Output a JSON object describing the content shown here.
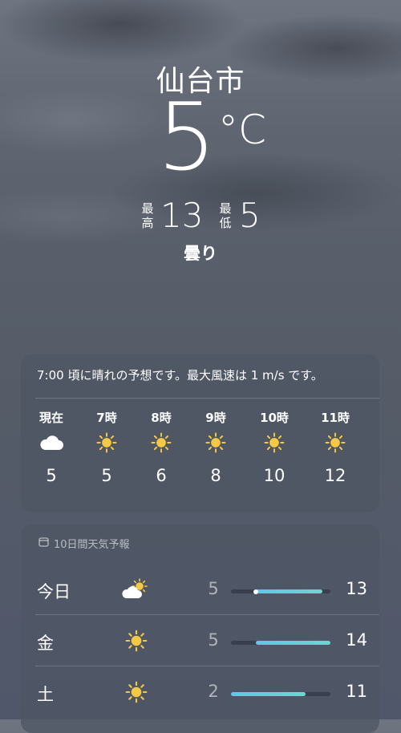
{
  "current": {
    "city": "仙台市",
    "temperature": "5",
    "unit": "°C",
    "high_label": "最高",
    "high": "13",
    "low_label": "最低",
    "low": "5",
    "condition": "曇り"
  },
  "hourly": {
    "summary": "7:00 頃に晴れの予想です。最大風速は 1 m/s です。",
    "items": [
      {
        "time": "現在",
        "icon": "cloud-icon",
        "temp": "5"
      },
      {
        "time": "7時",
        "icon": "sun-icon",
        "temp": "5"
      },
      {
        "time": "8時",
        "icon": "sun-icon",
        "temp": "6"
      },
      {
        "time": "9時",
        "icon": "sun-icon",
        "temp": "8"
      },
      {
        "time": "10時",
        "icon": "sun-icon",
        "temp": "10"
      },
      {
        "time": "11時",
        "icon": "sun-icon",
        "temp": "12"
      }
    ]
  },
  "daily": {
    "title": "10日間天気予報",
    "range_min": 2,
    "range_max": 14,
    "current_temp": 5,
    "days": [
      {
        "day": "今日",
        "icon": "partly-cloudy-icon",
        "low": "5",
        "high": "13"
      },
      {
        "day": "金",
        "icon": "sun-icon",
        "low": "5",
        "high": "14"
      },
      {
        "day": "土",
        "icon": "sun-icon",
        "low": "2",
        "high": "11"
      }
    ]
  },
  "colors": {
    "sun": "#f6c843",
    "bar_start": "#5cc8e8",
    "bar_end": "#6fd4cf"
  }
}
